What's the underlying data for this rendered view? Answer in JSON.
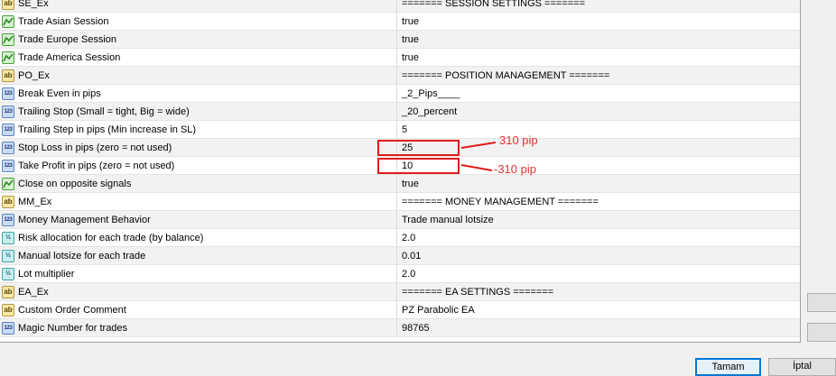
{
  "rows": [
    {
      "type": "ab",
      "name": "SE_Ex",
      "value": "======= SESSION SETTINGS ======="
    },
    {
      "type": "bool",
      "name": "Trade Asian Session",
      "value": "true"
    },
    {
      "type": "bool",
      "name": "Trade Europe Session",
      "value": "true"
    },
    {
      "type": "bool",
      "name": "Trade America Session",
      "value": "true"
    },
    {
      "type": "ab",
      "name": "PO_Ex",
      "value": "======= POSITION MANAGEMENT ======="
    },
    {
      "type": "123",
      "name": "Break Even in pips",
      "value": "_2_Pips____"
    },
    {
      "type": "123",
      "name": "Trailing Stop (Small = tight, Big = wide)",
      "value": "_20_percent"
    },
    {
      "type": "123",
      "name": "Trailing Step in pips (Min increase in SL)",
      "value": "5"
    },
    {
      "type": "123",
      "name": "Stop Loss in pips (zero = not used)",
      "value": "25"
    },
    {
      "type": "123",
      "name": "Take Profit in pips (zero = not used)",
      "value": "10"
    },
    {
      "type": "bool",
      "name": "Close on opposite signals",
      "value": "true"
    },
    {
      "type": "ab",
      "name": "MM_Ex",
      "value": "======= MONEY MANAGEMENT ======="
    },
    {
      "type": "123",
      "name": "Money Management Behavior",
      "value": "Trade manual lotsize"
    },
    {
      "type": "frac",
      "name": "Risk allocation for each trade (by balance)",
      "value": "2.0"
    },
    {
      "type": "frac",
      "name": "Manual lotsize for each trade",
      "value": "0.01"
    },
    {
      "type": "frac",
      "name": "Lot multiplier",
      "value": "2.0"
    },
    {
      "type": "ab",
      "name": "EA_Ex",
      "value": "======= EA SETTINGS ======="
    },
    {
      "type": "ab",
      "name": "Custom Order Comment",
      "value": "PZ Parabolic EA"
    },
    {
      "type": "123",
      "name": "Magic Number for trades",
      "value": "98765"
    }
  ],
  "icon_text": {
    "ab": "ab",
    "123": "123",
    "frac": "½"
  },
  "annotations": {
    "stop_loss_label": "310 pip",
    "take_profit_label": "-310 pip",
    "color": "#e11b1b"
  },
  "buttons": {
    "ok_label": "Tamam",
    "cancel_label": "İptal"
  }
}
